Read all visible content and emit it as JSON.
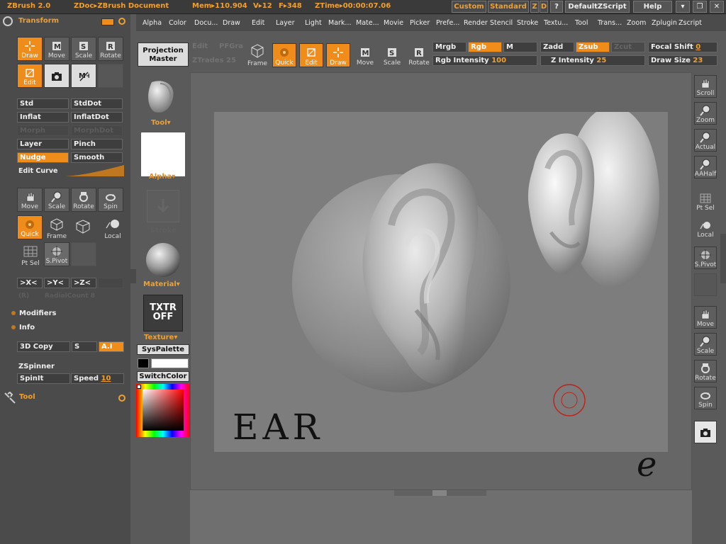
{
  "titlebar": {
    "app": "ZBrush 2.0",
    "document": "ZDoc▸ZBrush Document",
    "mem": "Mem▸110.904",
    "verts": "V▸12",
    "faces": "F▸348",
    "ztime": "ZTime▸00:00:07.06",
    "custom": "Custom",
    "standard": "Standard",
    "z": "Z",
    "d": "D",
    "q": "?",
    "zscript": "DefaultZScript",
    "help": "Help"
  },
  "menu": [
    "Alpha",
    "Color",
    "Docu...",
    "Draw",
    "Edit",
    "Layer",
    "Light",
    "Mark...",
    "Mate...",
    "Movie",
    "Picker",
    "Prefe...",
    "Render",
    "Stencil",
    "Stroke",
    "Textu...",
    "Tool",
    "Trans...",
    "Zoom",
    "Zplugin",
    "Zscript"
  ],
  "left": {
    "palette_title": "Transform",
    "tools_row1": [
      "Draw",
      "Move",
      "Scale",
      "Rotate"
    ],
    "edit": "Edit",
    "brushes": [
      "Std",
      "StdDot",
      "Inflat",
      "InflatDot",
      "Morph",
      "MorphDot",
      "Layer",
      "Pinch",
      "Nudge",
      "Smooth"
    ],
    "edit_curve": "Edit Curve",
    "nav": [
      "Move",
      "Scale",
      "Rotate",
      "Spin"
    ],
    "quick": "Quick",
    "frame": "Frame",
    "local": "Local",
    "ptsel": "Pt Sel",
    "spivot": "S.Pivot",
    "sym": [
      ">X<",
      ">Y<",
      ">Z<"
    ],
    "sym_r": "(R)",
    "radialcount": "RadialCount 8",
    "modifiers": "Modifiers",
    "info": "Info",
    "copy3d": "3D Copy",
    "s": "S",
    "ai": "A.I",
    "zspinner": "ZSpinner",
    "spinit": "SpinIt",
    "speed_label": "Speed",
    "speed_value": "10",
    "tool": "Tool"
  },
  "mid": {
    "projection": "Projection Master",
    "tool_label": "Tool",
    "alpha_label": "Alpha",
    "stroke_label": "Stroke",
    "material_label": "Material",
    "txtr_line1": "TXTR",
    "txtr_line2": "OFF",
    "texture_label": "Texture",
    "syspalette": "SysPalette",
    "switchcolor": "SwitchColor"
  },
  "toolbar": {
    "edit_ghost": "Edit",
    "pfgra": "PFGra",
    "ztrades": "ZTrades 25",
    "frame": "Frame",
    "quick": "Quick",
    "edit": "Edit",
    "draw": "Draw",
    "move": "Move",
    "scale": "Scale",
    "rotate": "Rotate",
    "mrgb": "Mrgb",
    "rgb": "Rgb",
    "m": "M",
    "rgb_intensity": "Rgb Intensity",
    "rgb_intensity_value": "100",
    "zadd": "Zadd",
    "zsub": "Zsub",
    "zcut": "Zcut",
    "z_intensity": "Z Intensity",
    "z_intensity_value": "25",
    "focal_shift": "Focal Shift",
    "focal_shift_value": "0",
    "draw_size": "Draw Size",
    "draw_size_value": "23"
  },
  "right": [
    "Scroll",
    "Zoom",
    "Actual",
    "AAHalf",
    "Pt Sel",
    "Local",
    "S.Pivot",
    "Move",
    "Scale",
    "Rotate",
    "Spin"
  ],
  "canvas": {
    "text": "EAR",
    "signature": "e"
  },
  "colors": {
    "accent": "#f08c1a",
    "panel": "#4b4b4b",
    "canvas_bg": "#7d7d7d"
  }
}
